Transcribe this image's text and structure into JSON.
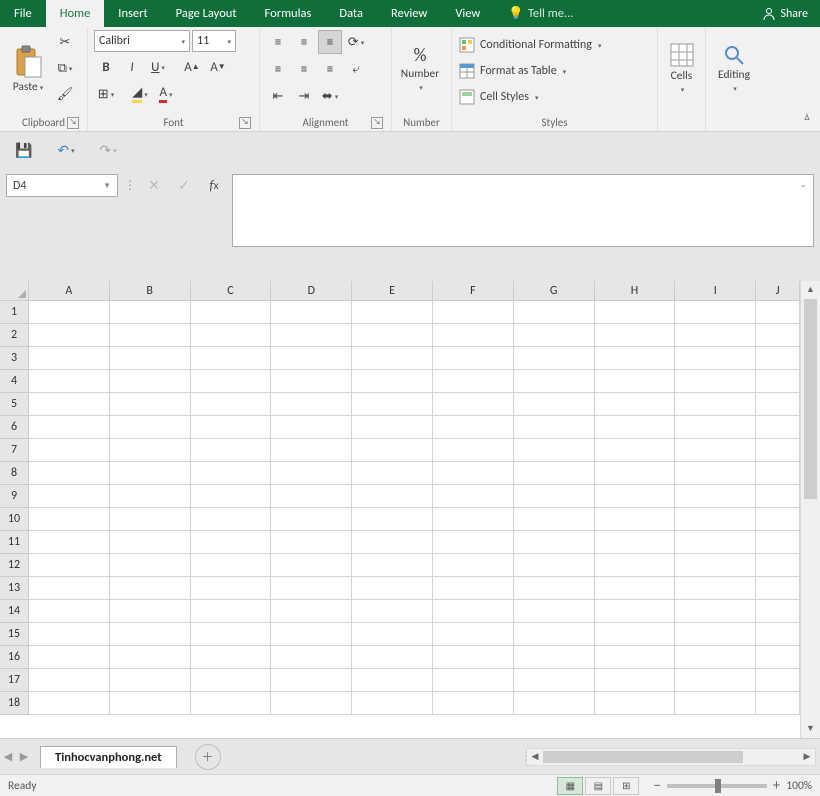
{
  "tabs": [
    "File",
    "Home",
    "Insert",
    "Page Layout",
    "Formulas",
    "Data",
    "Review",
    "View"
  ],
  "active_tab": "Home",
  "tell_me": "Tell me...",
  "share": "Share",
  "clipboard": {
    "label": "Clipboard",
    "paste": "Paste"
  },
  "font": {
    "label": "Font",
    "name": "Calibri",
    "size": "11"
  },
  "alignment": {
    "label": "Alignment"
  },
  "number": {
    "label": "Number",
    "btn": "Number"
  },
  "styles": {
    "label": "Styles",
    "cond": "Conditional Formatting",
    "table": "Format as Table",
    "cell": "Cell Styles"
  },
  "cells": {
    "label": "Cells"
  },
  "editing": {
    "label": "Editing"
  },
  "namebox": "D4",
  "columns": [
    "A",
    "B",
    "C",
    "D",
    "E",
    "F",
    "G",
    "H",
    "I",
    "J"
  ],
  "rows": [
    "1",
    "2",
    "3",
    "4",
    "5",
    "6",
    "7",
    "8",
    "9",
    "10",
    "11",
    "12",
    "13",
    "14",
    "15",
    "16",
    "17",
    "18"
  ],
  "sheet_name": "Tinhocvanphong.net",
  "status": "Ready",
  "zoom": "100%"
}
